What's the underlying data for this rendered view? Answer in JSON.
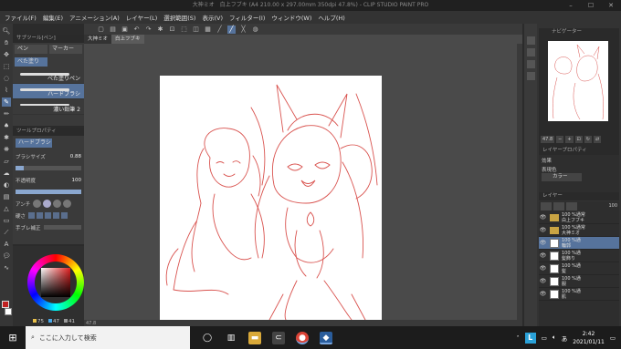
{
  "window": {
    "title": "大神ミオ　白上フブキ (A4 210.00 x 297.00mm 350dpi 47.8%) - CLIP STUDIO PAINT PRO",
    "controls": [
      "–",
      "☐",
      "✕"
    ]
  },
  "menu": [
    "ファイル(F)",
    "編集(E)",
    "アニメーション(A)",
    "レイヤー(L)",
    "選択範囲(S)",
    "表示(V)",
    "フィルター(I)",
    "ウィンドウ(W)",
    "ヘルプ(H)"
  ],
  "subtool_panel": {
    "header": "サブツール[ペン]",
    "tabs": [
      "ペン",
      "マーカー"
    ],
    "active_tab_label": "べた塗り",
    "brushes": [
      "べた塗りペン",
      "ハードブラシ",
      "濃い鉛筆 2"
    ]
  },
  "tool_property": {
    "header": "ツールプロパティ",
    "tool_name": "ハードブラシ",
    "brush_size_label": "ブラシサイズ",
    "brush_size_value": "0.88",
    "brush_size_level": 0.12,
    "opacity_label": "不透明度",
    "opacity_value": "100",
    "opacity_level": 1.0,
    "antialias_label": "アンチ",
    "hardness_label": "硬さ",
    "hand_correction_label": "手ブレ補正"
  },
  "color_panel": {
    "h": "75",
    "s": "47",
    "v": "41",
    "main_color": "#c02020"
  },
  "canvas": {
    "doc_tabs": [
      "大神ミオ",
      "白上フブキ"
    ],
    "zoom": "47.8"
  },
  "right_panel": {
    "navigator_header": "ナビゲーター",
    "navigator_zoom": "47.8",
    "layer_property_header": "レイヤープロパティ",
    "effect_label": "効果",
    "expression_label": "表現色",
    "color_mode": "カラー",
    "layer_header": "レイヤー",
    "layer_opacity": "100",
    "layers": [
      {
        "line1": "100 %通常",
        "line2": "白上フブキ",
        "type": "folder"
      },
      {
        "line1": "100 %通常",
        "line2": "大神ミオ",
        "type": "folder"
      },
      {
        "line1": "100 %通",
        "line2": "輪郭",
        "type": "layer"
      },
      {
        "line1": "100 %通",
        "line2": "髪飾り",
        "type": "layer"
      },
      {
        "line1": "100 %通",
        "line2": "髪",
        "type": "layer"
      },
      {
        "line1": "100 %通",
        "line2": "服",
        "type": "layer"
      },
      {
        "line1": "100 %通",
        "line2": "肌",
        "type": "layer"
      }
    ]
  },
  "taskbar": {
    "search_placeholder": "ここに入力して検索",
    "time": "2:42",
    "date": "2021/01/11",
    "tray_ime": "あ",
    "tray_l": "L"
  },
  "colors": {
    "accent": "#56739c",
    "sketch": "#d9534f"
  }
}
